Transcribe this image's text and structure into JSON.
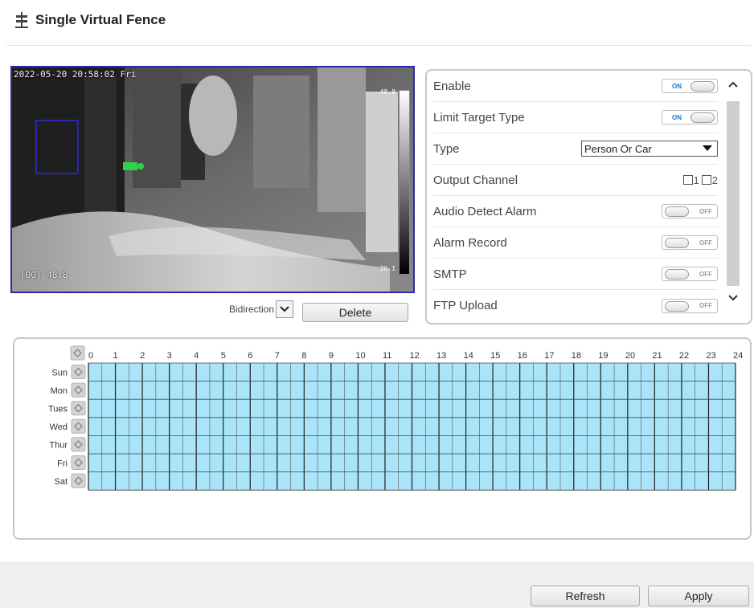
{
  "header": {
    "title": "Single Virtual Fence",
    "icon": "fence-icon"
  },
  "video": {
    "timestamp": "2022-05-20 20:58:02 Fri",
    "temp_readout": "[00] 48.8",
    "scale_max": "48.8",
    "scale_min": "26.1"
  },
  "controls": {
    "direction_value": "Bidirectional",
    "delete_label": "Delete"
  },
  "settings": {
    "enable": {
      "label": "Enable",
      "state": "ON"
    },
    "limit_target": {
      "label": "Limit Target Type",
      "state": "ON"
    },
    "type": {
      "label": "Type",
      "value": "Person Or Car"
    },
    "output_channel": {
      "label": "Output Channel",
      "ch1": "1",
      "ch2": "2"
    },
    "audio_alarm": {
      "label": "Audio Detect Alarm",
      "state": "OFF"
    },
    "alarm_record": {
      "label": "Alarm Record",
      "state": "OFF"
    },
    "smtp": {
      "label": "SMTP",
      "state": "OFF"
    },
    "ftp_upload": {
      "label": "FTP Upload",
      "state": "OFF"
    }
  },
  "schedule": {
    "days": [
      "Sun",
      "Mon",
      "Tues",
      "Wed",
      "Thur",
      "Fri",
      "Sat"
    ],
    "hours": [
      "0",
      "1",
      "2",
      "3",
      "4",
      "5",
      "6",
      "7",
      "8",
      "9",
      "10",
      "11",
      "12",
      "13",
      "14",
      "15",
      "16",
      "17",
      "18",
      "19",
      "20",
      "21",
      "22",
      "23",
      "24"
    ],
    "fill_color": "#a9e4f8",
    "all_selected": true
  },
  "footer": {
    "refresh_label": "Refresh",
    "apply_label": "Apply"
  },
  "colors": {
    "video_border": "#2a2aa8",
    "on_text": "#1e73d0",
    "grid_fill": "#a9e4f8"
  }
}
